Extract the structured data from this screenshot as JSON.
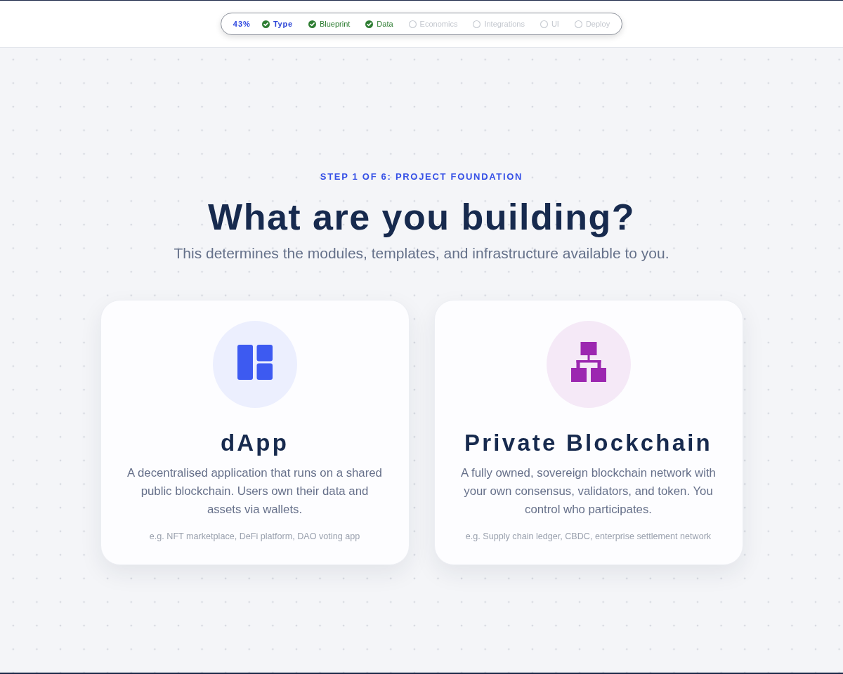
{
  "header": {
    "progress": "43%",
    "steps": [
      {
        "label": "Type",
        "done": true,
        "selected": true
      },
      {
        "label": "Blueprint",
        "done": true,
        "selected": false
      },
      {
        "label": "Data",
        "done": true,
        "selected": false
      },
      {
        "label": "Economics",
        "done": false,
        "selected": false
      },
      {
        "label": "Integrations",
        "done": false,
        "selected": false
      },
      {
        "label": "UI",
        "done": false,
        "selected": false
      },
      {
        "label": "Deploy",
        "done": false,
        "selected": false
      }
    ]
  },
  "intro": {
    "eyebrow": "STEP 1 OF 6: PROJECT FOUNDATION",
    "title": "What are you building?",
    "subtitle": "This determines the modules, templates, and infrastructure available to you."
  },
  "options": [
    {
      "kind": "app",
      "color": "#3d5af1",
      "title": "dApp",
      "description": "A decentralised application that runs on a shared public blockchain. Users own their data and assets via wallets.",
      "examples": "e.g. NFT marketplace, DeFi platform, DAO voting app"
    },
    {
      "kind": "network",
      "color": "#9c27b0",
      "title": "Private Blockchain",
      "description": "A fully owned, sovereign blockchain network with your own consensus, validators, and token. You control who participates.",
      "examples": "e.g. Supply chain ledger, CBDC, enterprise settlement network"
    }
  ]
}
